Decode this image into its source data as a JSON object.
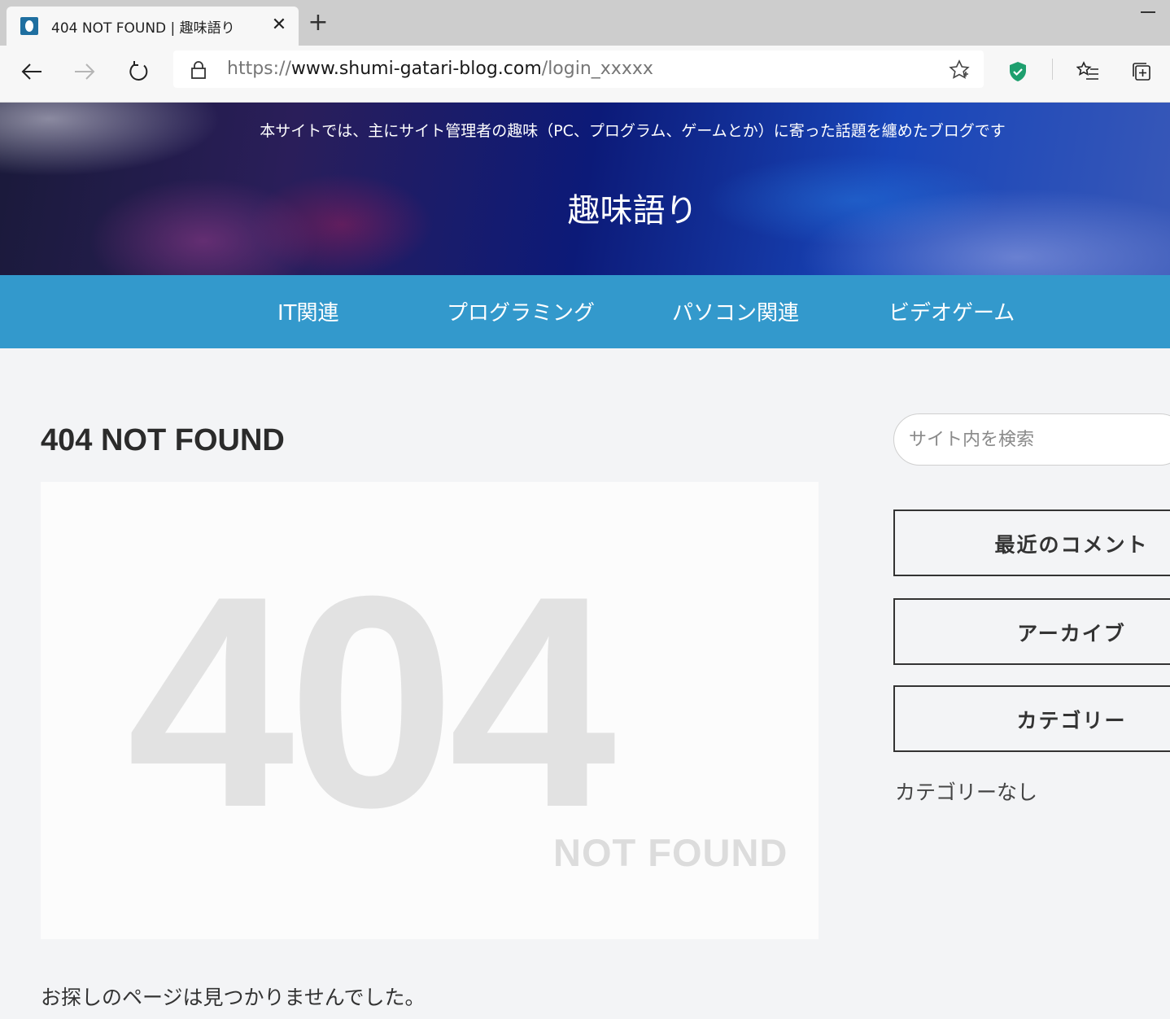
{
  "browser": {
    "tab_title": "404 NOT FOUND | 趣味語り",
    "tab_close": "✕",
    "new_tab": "+",
    "url_scheme": "https://",
    "url_host": "www.shumi-gatari-blog.com",
    "url_path": "/login_xxxxx"
  },
  "header": {
    "tagline": "本サイトでは、主にサイト管理者の趣味（PC、プログラム、ゲームとか）に寄った話題を纏めたブログです",
    "site_title": "趣味語り"
  },
  "nav": {
    "items": [
      {
        "label": "IT関連"
      },
      {
        "label": "プログラミング"
      },
      {
        "label": "パソコン関連"
      },
      {
        "label": "ビデオゲーム"
      }
    ]
  },
  "main": {
    "page_title": "404 NOT FOUND",
    "image_big": "404",
    "image_small": "NOT FOUND",
    "message": "お探しのページは見つかりませんでした。"
  },
  "sidebar": {
    "search_placeholder": "サイト内を検索",
    "widgets": [
      {
        "title": "最近のコメント"
      },
      {
        "title": "アーカイブ"
      },
      {
        "title": "カテゴリー"
      }
    ],
    "no_category": "カテゴリーなし"
  },
  "colors": {
    "nav_bg": "#3399cc",
    "page_bg": "#f3f4f6",
    "shield": "#1e9f6e"
  }
}
